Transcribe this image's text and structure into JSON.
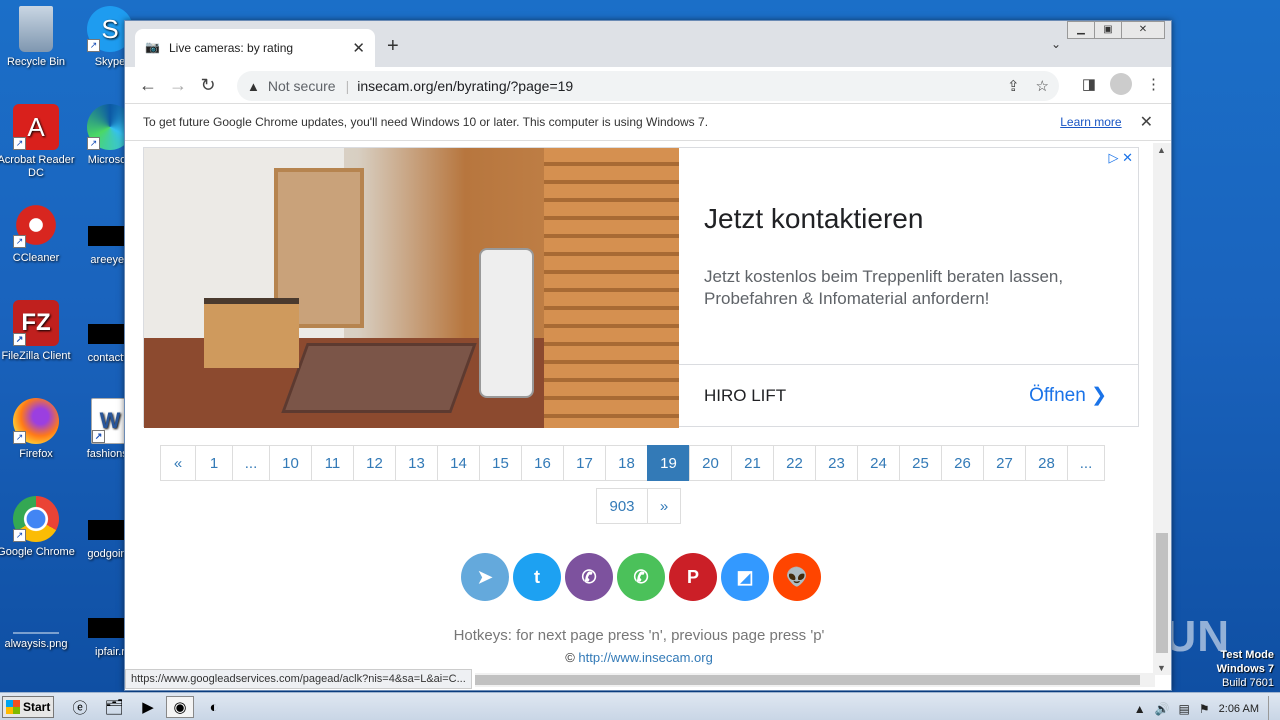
{
  "desktop": {
    "icons": [
      {
        "label": "Recycle Bin",
        "icon": "recycle-bin-icon"
      },
      {
        "label": "Skype",
        "icon": "skype-icon"
      },
      {
        "label": "Acrobat Reader DC",
        "icon": "acrobat-icon"
      },
      {
        "label": "Microsoft",
        "icon": "edge-icon"
      },
      {
        "label": "CCleaner",
        "icon": "ccleaner-icon"
      },
      {
        "label": "areeyes",
        "icon": "file-icon"
      },
      {
        "label": "FileZilla Client",
        "icon": "filezilla-icon"
      },
      {
        "label": "contactfri",
        "icon": "file-icon"
      },
      {
        "label": "Firefox",
        "icon": "firefox-icon"
      },
      {
        "label": "fashionsy",
        "icon": "word-icon"
      },
      {
        "label": "Google Chrome",
        "icon": "chrome-icon"
      },
      {
        "label": "godgoing",
        "icon": "file-icon"
      },
      {
        "label": "alwaysis.png",
        "icon": "image-icon"
      },
      {
        "label": "ipfair.r",
        "icon": "file-icon"
      }
    ],
    "watermark": "ANY RUN",
    "testmode": {
      "line1": "Test Mode",
      "line2": "Windows 7",
      "line3": "Build 7601"
    }
  },
  "browser": {
    "tab_title": "Live cameras: by rating",
    "tab_close": "✕",
    "new_tab": "+",
    "security_label": "Not secure",
    "url": "insecam.org/en/byrating/?page=19",
    "infobar_message": "To get future Google Chrome updates, you'll need Windows 10 or later. This computer is using Windows 7.",
    "infobar_link": "Learn more",
    "status_url": "https://www.googleadservices.com/pagead/aclk?nis=4&sa=L&ai=C..."
  },
  "ad": {
    "headline": "Jetzt kontaktieren",
    "description": "Jetzt kostenlos beim Treppenlift beraten lassen, Probefahren & Infomaterial anfordern!",
    "brand": "HIRO LIFT",
    "cta": "Öffnen ❯"
  },
  "pagination": {
    "row1": [
      "«",
      "1",
      "...",
      "10",
      "11",
      "12",
      "13",
      "14",
      "15",
      "16",
      "17",
      "18",
      "19",
      "20",
      "21",
      "22",
      "23",
      "24",
      "25",
      "26",
      "27",
      "28",
      "..."
    ],
    "row2": [
      "903",
      "»"
    ],
    "active": "19"
  },
  "share": [
    {
      "name": "telegram",
      "color": "#64a9dc"
    },
    {
      "name": "twitter",
      "color": "#1da1f2"
    },
    {
      "name": "viber",
      "color": "#7d529e"
    },
    {
      "name": "whatsapp",
      "color": "#4bc15a"
    },
    {
      "name": "pinterest",
      "color": "#cb1f27"
    },
    {
      "name": "delicious",
      "color": "#3399ff"
    },
    {
      "name": "reddit",
      "color": "#ff4500"
    }
  ],
  "footer": {
    "hotkeys": "Hotkeys: for next page press 'n', previous page press 'p'",
    "copyright_symbol": "©",
    "copyright_link": "http://www.insecam.org"
  },
  "taskbar": {
    "start_label": "Start",
    "clock": "2:06 AM"
  }
}
